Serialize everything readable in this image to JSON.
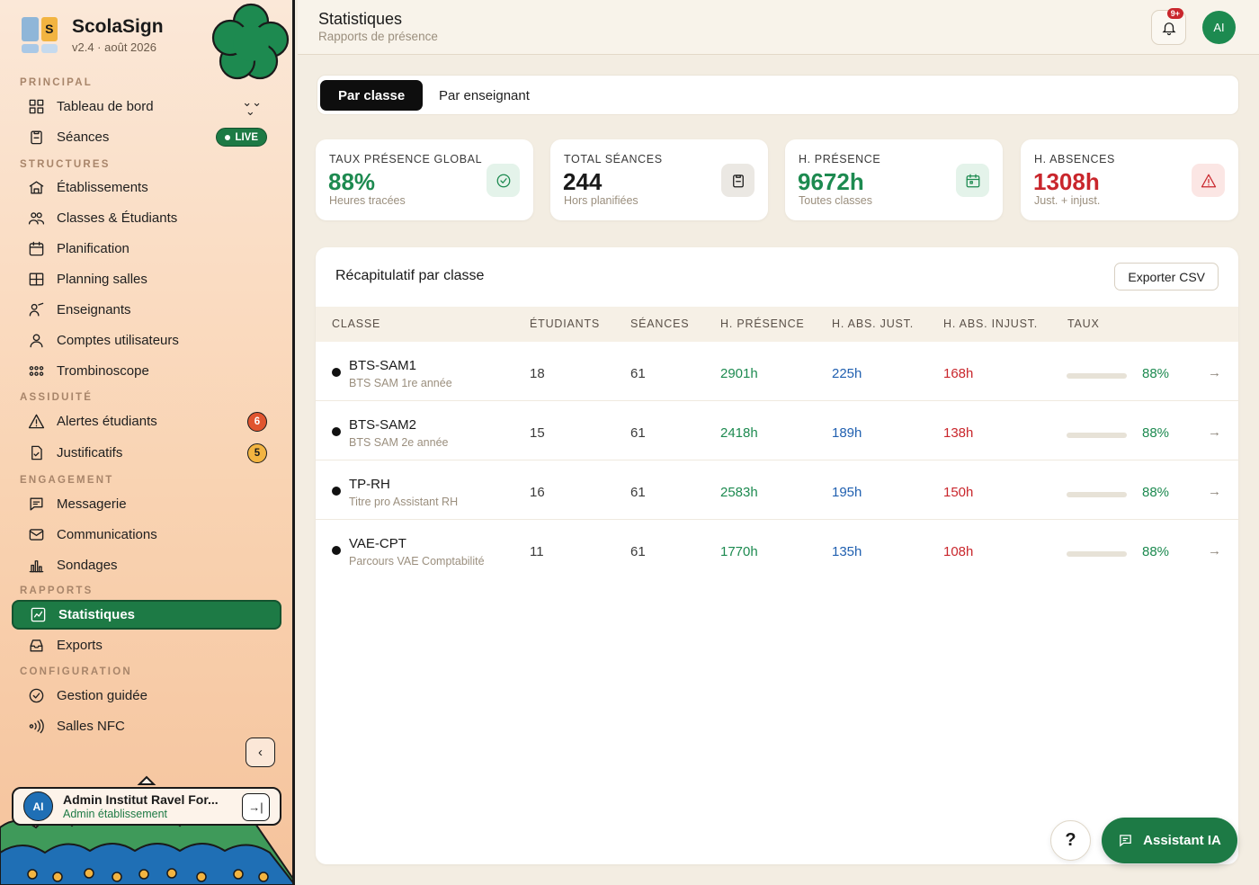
{
  "brand": {
    "name": "ScolaSign",
    "version": "v2.4 · août 2026",
    "logo_letter": "S"
  },
  "sidebar": {
    "sections": {
      "principal": "PRINCIPAL",
      "structures": "STRUCTURES",
      "assiduite": "ASSIDUITÉ",
      "engagement": "ENGAGEMENT",
      "rapports": "RAPPORTS",
      "configuration": "CONFIGURATION"
    },
    "items": {
      "tableau": "Tableau de bord",
      "seances": "Séances",
      "etablissements": "Établissements",
      "classes": "Classes & Étudiants",
      "planification": "Planification",
      "planning_salles": "Planning salles",
      "enseignants": "Enseignants",
      "comptes": "Comptes utilisateurs",
      "trombinoscope": "Trombinoscope",
      "alertes": "Alertes étudiants",
      "justificatifs": "Justificatifs",
      "messagerie": "Messagerie",
      "communications": "Communications",
      "sondages": "Sondages",
      "statistiques": "Statistiques",
      "exports": "Exports",
      "gestion": "Gestion guidée",
      "salles_nfc": "Salles NFC"
    },
    "live_label": "LIVE",
    "alertes_count": "6",
    "justificatifs_count": "5",
    "user": {
      "initials": "AI",
      "name": "Admin Institut Ravel For...",
      "role": "Admin établissement"
    }
  },
  "header": {
    "title": "Statistiques",
    "subtitle": "Rapports de présence",
    "notif_count": "9+",
    "avatar": "AI"
  },
  "tabs": {
    "active": "Par classe",
    "inactive": "Par enseignant"
  },
  "stats": [
    {
      "label": "TAUX PRÉSENCE GLOBAL",
      "value": "88%",
      "sub": "Heures tracées",
      "color": "#1d8a50"
    },
    {
      "label": "TOTAL SÉANCES",
      "value": "244",
      "sub": "Hors planifiées",
      "color": "#1a1a1a"
    },
    {
      "label": "H. PRÉSENCE",
      "value": "9672h",
      "sub": "Toutes classes",
      "color": "#1d8a50"
    },
    {
      "label": "H. ABSENCES",
      "value": "1308h",
      "sub": "Just. + injust.",
      "color": "#c9262c"
    }
  ],
  "table": {
    "title": "Récapitulatif par classe",
    "export_label": "Exporter CSV",
    "headers": {
      "classe": "CLASSE",
      "etudiants": "ÉTUDIANTS",
      "seances": "SÉANCES",
      "presence": "H. PRÉSENCE",
      "abs_just": "H. ABS. JUST.",
      "abs_injust": "H. ABS. INJUST.",
      "taux": "TAUX"
    },
    "rows": [
      {
        "name": "BTS-SAM1",
        "desc": "BTS SAM 1re année",
        "etudiants": "18",
        "seances": "61",
        "presence": "2901h",
        "abs_just": "225h",
        "abs_injust": "168h",
        "taux": "88%",
        "taux_value": 88,
        "arrow": "→"
      },
      {
        "name": "BTS-SAM2",
        "desc": "BTS SAM 2e année",
        "etudiants": "15",
        "seances": "61",
        "presence": "2418h",
        "abs_just": "189h",
        "abs_injust": "138h",
        "taux": "88%",
        "taux_value": 88,
        "arrow": "→"
      },
      {
        "name": "TP-RH",
        "desc": "Titre pro Assistant RH",
        "etudiants": "16",
        "seances": "61",
        "presence": "2583h",
        "abs_just": "195h",
        "abs_injust": "150h",
        "taux": "88%",
        "taux_value": 88,
        "arrow": "→"
      },
      {
        "name": "VAE-CPT",
        "desc": "Parcours VAE Comptabilité",
        "etudiants": "11",
        "seances": "61",
        "presence": "1770h",
        "abs_just": "135h",
        "abs_injust": "108h",
        "taux": "88%",
        "taux_value": 88,
        "arrow": "→"
      }
    ]
  },
  "floating": {
    "help": "?",
    "assistant": "Assistant IA"
  }
}
